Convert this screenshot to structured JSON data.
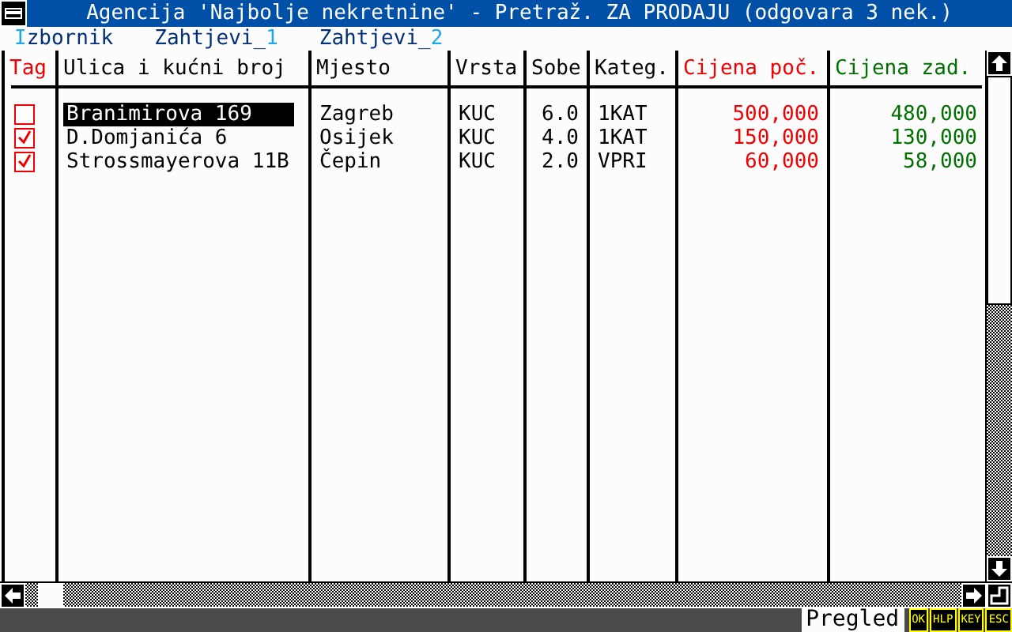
{
  "window": {
    "title": "Agencija 'Najbolje nekretnine' - Pretraž. ZA PRODAJU (odgovara 3 nek.)"
  },
  "menu": [
    {
      "key": "I",
      "rest": "zbornik"
    },
    {
      "lead": "Zahtjevi_",
      "key": "1"
    },
    {
      "lead": "Zahtjevi_",
      "key": "2"
    }
  ],
  "table": {
    "columns": [
      {
        "label": "Tag",
        "color": "#f00000"
      },
      {
        "label": "Ulica i kućni broj",
        "color": "#000000"
      },
      {
        "label": "Mjesto",
        "color": "#000000"
      },
      {
        "label": "Vrsta",
        "color": "#000000"
      },
      {
        "label": "Sobe",
        "color": "#000000"
      },
      {
        "label": "Kateg.",
        "color": "#000000"
      },
      {
        "label": "Cijena poč.",
        "color": "#f00000"
      },
      {
        "label": "Cijena zad.",
        "color": "#007000"
      }
    ],
    "rows": [
      {
        "tagged": false,
        "selected": true,
        "street": "Branimirova 169",
        "place": "Zagreb",
        "type": "KUC",
        "rooms": "6.0",
        "category": "1KAT",
        "price_start": "500,000",
        "price_end": "480,000"
      },
      {
        "tagged": true,
        "selected": false,
        "street": "D.Domjanića 6",
        "place": "Osijek",
        "type": "KUC",
        "rooms": "4.0",
        "category": "1KAT",
        "price_start": "150,000",
        "price_end": "130,000"
      },
      {
        "tagged": true,
        "selected": false,
        "street": "Strossmayerova 11B",
        "place": "Čepin",
        "type": "KUC",
        "rooms": "2.0",
        "category": "VPRI",
        "price_start": "60,000",
        "price_end": "58,000"
      }
    ]
  },
  "status_bar": {
    "mode": "Pregled",
    "keys": [
      "OK",
      "HLP",
      "KEY",
      "ESC"
    ]
  }
}
